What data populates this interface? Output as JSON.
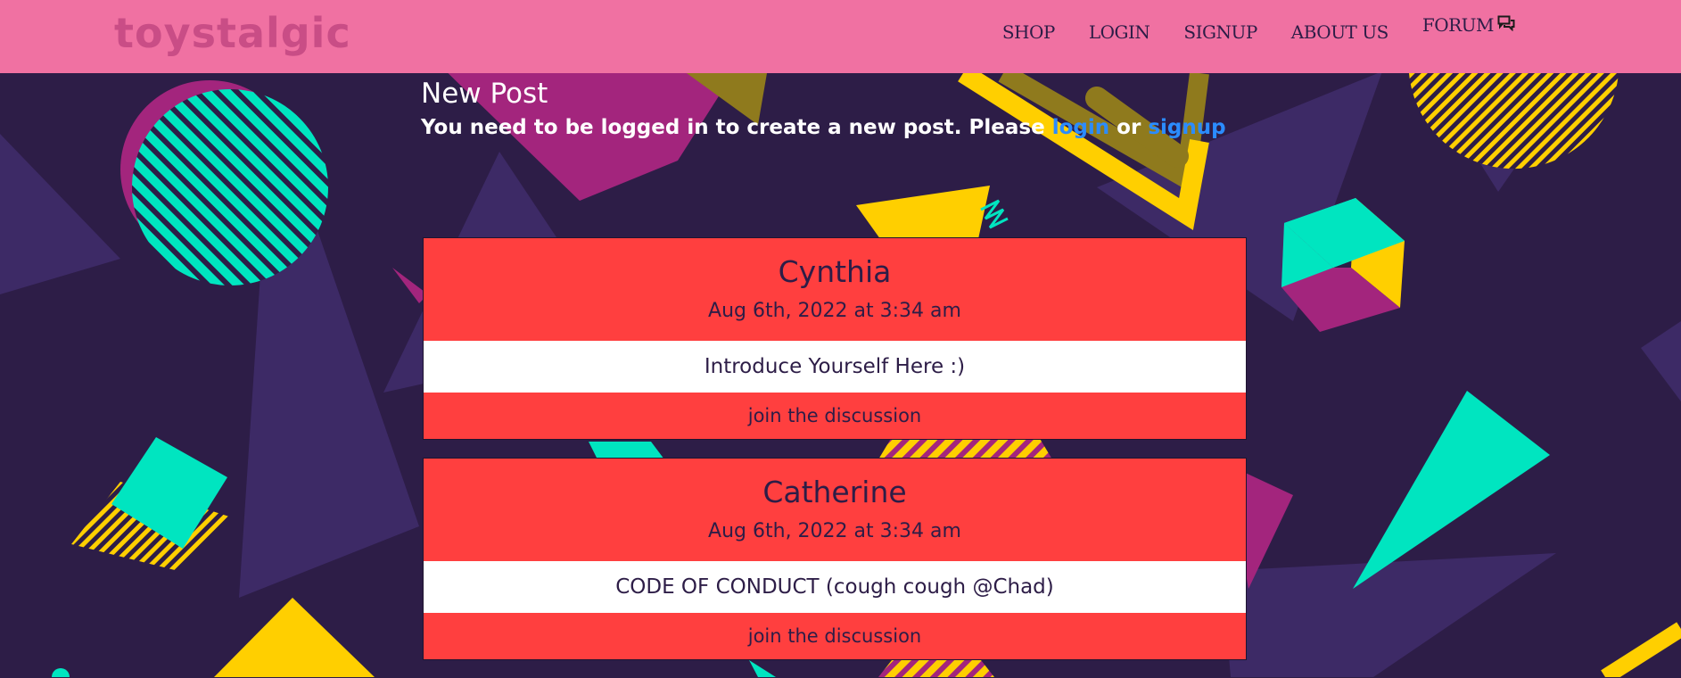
{
  "nav": {
    "logo": "toystalgic",
    "links": {
      "shop": "SHOP",
      "login": "LOGIN",
      "signup": "SIGNUP",
      "about": "ABOUT US",
      "forum": "FORUM"
    },
    "forum_icon": "chat-bubbles-icon"
  },
  "new_post": {
    "title": "New Post",
    "message_prefix": "You need to be logged in to create a new post. Please",
    "login_link": "login",
    "or_text": "or",
    "signup_link": "signup"
  },
  "posts": [
    {
      "author": "Cynthia",
      "date": "Aug 6th, 2022 at 3:34 am",
      "title": "Introduce Yourself Here :)",
      "join_label": "join the discussion"
    },
    {
      "author": "Catherine",
      "date": "Aug 6th, 2022 at 3:34 am",
      "title": "CODE OF CONDUCT (cough cough @Chad)",
      "join_label": "join the discussion"
    }
  ],
  "colors": {
    "navbar": "#f071a2",
    "background": "#2d1d47",
    "card_red": "#ff3f3f",
    "link_blue": "#2b8cff",
    "accent_yellow": "#ffcf00",
    "accent_teal": "#00e5c0",
    "accent_magenta": "#a3257d"
  }
}
